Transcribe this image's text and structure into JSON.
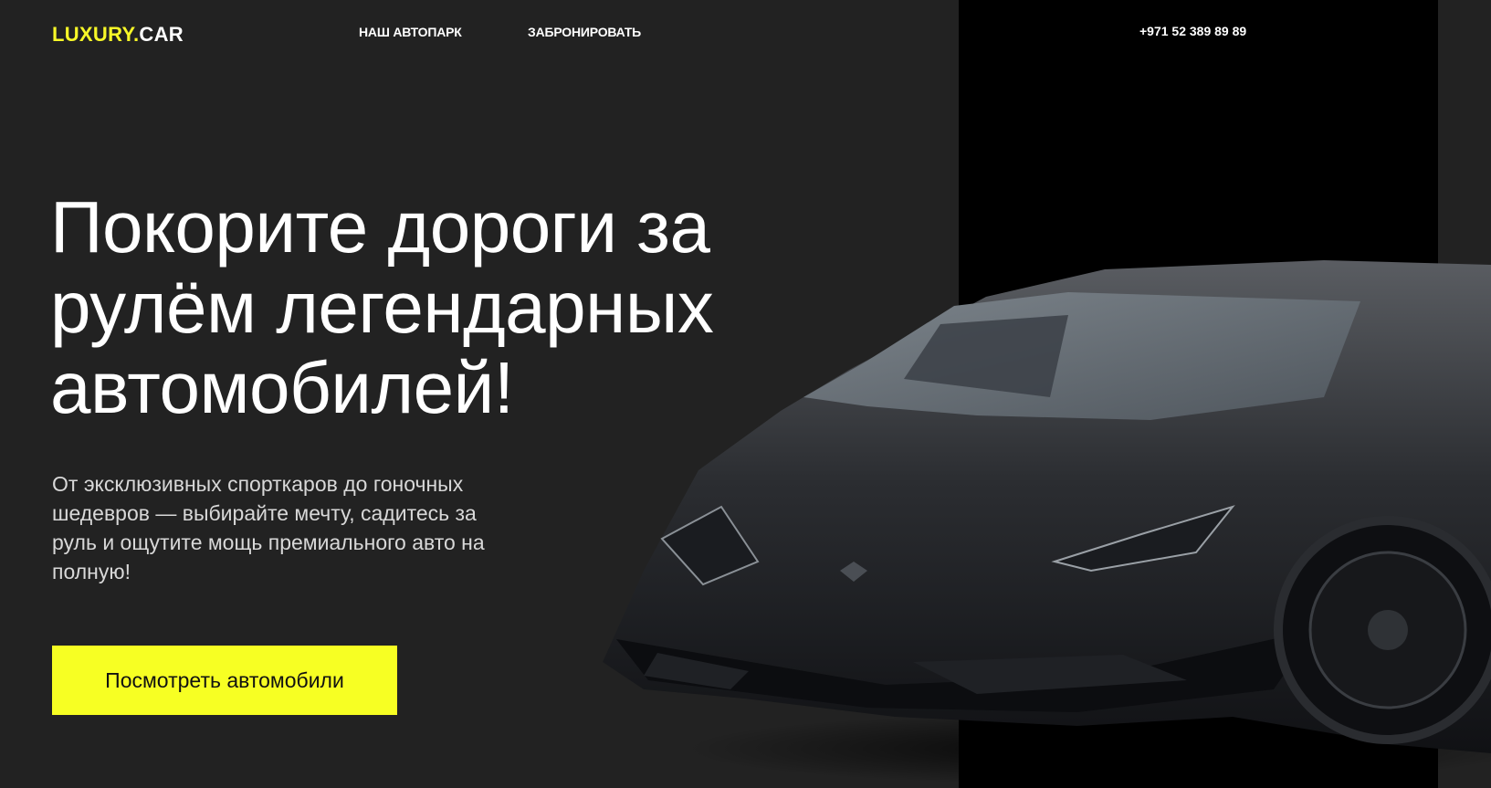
{
  "header": {
    "logo_brand": "LUXURY.",
    "logo_tld": "CAR",
    "nav": {
      "fleet": "НАШ АВТОПАРК",
      "book": "ЗАБРОНИРОВАТЬ"
    },
    "phone": "+971 52 389 89 89"
  },
  "hero": {
    "title": "Покорите дороги за рулём легендарных автомобилей!",
    "subtitle": "От эксклюзивных спорткаров до гоночных шедевров — выбирайте мечту, садитесь за руль и ощутите мощь премиального авто на полную!",
    "cta_label": "Посмотреть автомобили"
  },
  "colors": {
    "background": "#222222",
    "panel": "#000000",
    "accent": "#f7ff23",
    "logo_accent": "#f7f728"
  },
  "image": {
    "hero_car": "black-sports-car-illustration"
  }
}
